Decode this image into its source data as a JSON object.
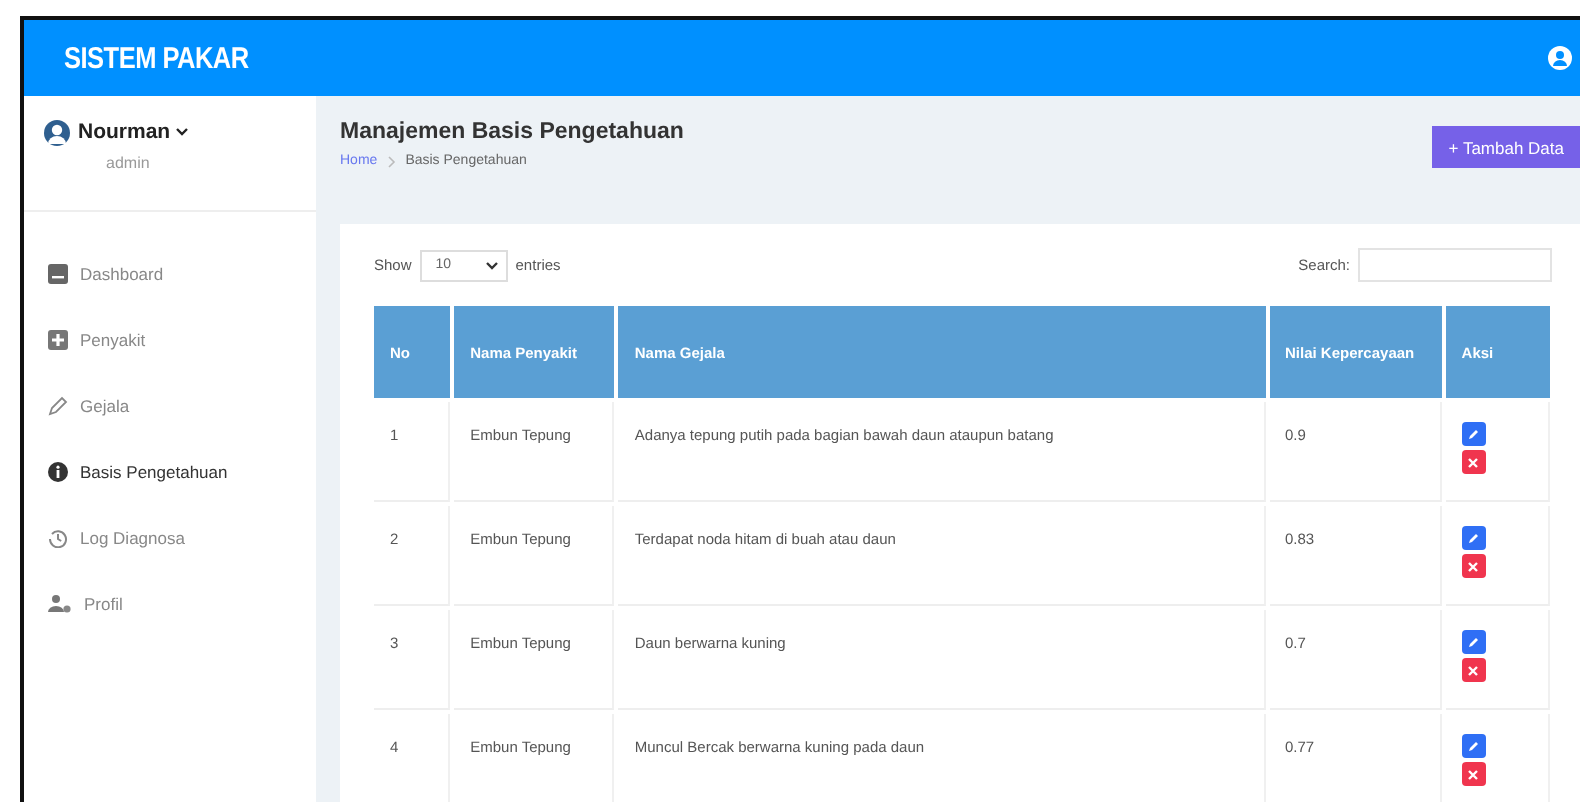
{
  "header": {
    "brand": "SISTEM PAKAR"
  },
  "user": {
    "name": "Nourman",
    "role": "admin"
  },
  "sidebar": {
    "items": [
      {
        "label": "Dashboard",
        "kind": "dashboard",
        "selected": false
      },
      {
        "label": "Penyakit",
        "kind": "disease",
        "selected": false
      },
      {
        "label": "Gejala",
        "kind": "symptom",
        "selected": false
      },
      {
        "label": "Basis Pengetahuan",
        "kind": "knowledge",
        "selected": true
      },
      {
        "label": "Log Diagnosa",
        "kind": "log",
        "selected": false
      },
      {
        "label": "Profil",
        "kind": "profile",
        "selected": false
      }
    ]
  },
  "page": {
    "title": "Manajemen Basis Pengetahuan",
    "breadcrumb": [
      "Home",
      "Basis Pengetahuan"
    ],
    "add_button": "+ Tambah Data"
  },
  "table_controls": {
    "show_label": "Show",
    "entries_value": "10",
    "entries_label": "entries",
    "search_label": "Search:"
  },
  "table": {
    "columns": [
      "No",
      "Nama Penyakit",
      "Nama Gejala",
      "Nilai Kepercayaan",
      "Aksi"
    ],
    "rows": [
      [
        "1",
        "Embun Tepung",
        "Adanya tepung putih pada bagian bawah daun ataupun batang",
        "0.9"
      ],
      [
        "2",
        "Embun Tepung",
        "Terdapat noda hitam di buah atau daun",
        "0.83"
      ],
      [
        "3",
        "Embun Tepung",
        "Daun berwarna kuning",
        "0.7"
      ],
      [
        "4",
        "Embun Tepung",
        "Muncul Bercak berwarna kuning pada daun",
        "0.77"
      ]
    ]
  }
}
